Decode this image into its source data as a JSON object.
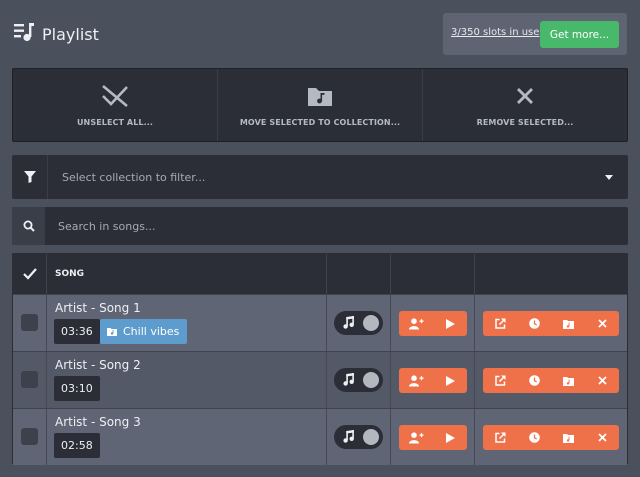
{
  "header": {
    "title": "Playlist",
    "slots_text": "3/350 slots in use",
    "get_more_label": "Get more..."
  },
  "actions": [
    {
      "label": "UNSELECT ALL...",
      "icon": "unselect-icon"
    },
    {
      "label": "MOVE SELECTED TO COLLECTION...",
      "icon": "folder-music-icon"
    },
    {
      "label": "REMOVE SELECTED...",
      "icon": "close-icon"
    }
  ],
  "filter": {
    "placeholder": "Select collection to filter..."
  },
  "search": {
    "placeholder": "Search in songs..."
  },
  "table": {
    "column_song": "SONG",
    "rows": [
      {
        "song": "Artist - Song 1",
        "duration": "03:36",
        "collection": "Chill vibes"
      },
      {
        "song": "Artist - Song 2",
        "duration": "03:10",
        "collection": ""
      },
      {
        "song": "Artist - Song 3",
        "duration": "02:58",
        "collection": ""
      }
    ]
  },
  "colors": {
    "background": "#4b505d",
    "panel": "#2b2e36",
    "accent_green": "#48b86b",
    "accent_orange": "#ee7149",
    "collection_blue": "#5d9ccc"
  }
}
